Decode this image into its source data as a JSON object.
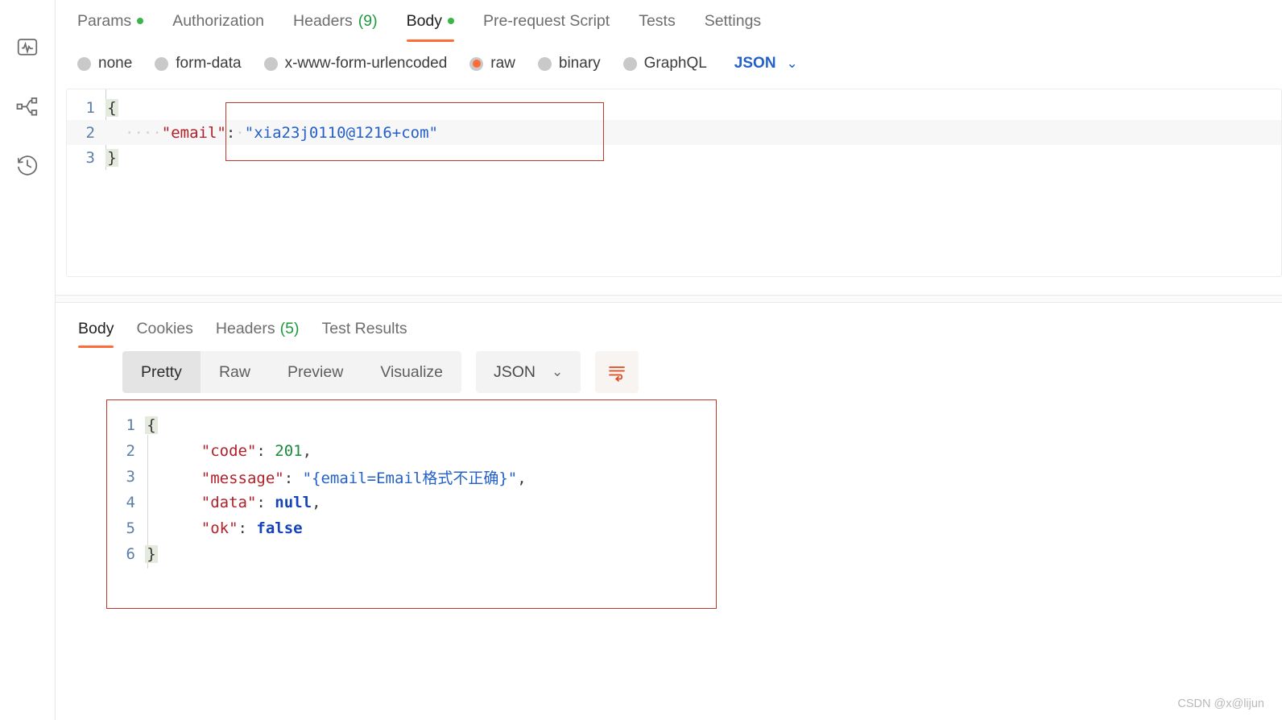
{
  "sidebar": {
    "items": [
      {
        "name": "monitor-icon",
        "label": "Monitors"
      },
      {
        "name": "flow-icon",
        "label": "Flows"
      },
      {
        "name": "history-icon",
        "label": "History"
      }
    ]
  },
  "request": {
    "tabs": [
      {
        "label": "Params",
        "badge_dot": true,
        "count": "",
        "active": false
      },
      {
        "label": "Authorization",
        "badge_dot": false,
        "count": "",
        "active": false
      },
      {
        "label": "Headers",
        "badge_dot": false,
        "count": "(9)",
        "active": false
      },
      {
        "label": "Body",
        "badge_dot": true,
        "count": "",
        "active": true
      },
      {
        "label": "Pre-request Script",
        "badge_dot": false,
        "count": "",
        "active": false
      },
      {
        "label": "Tests",
        "badge_dot": false,
        "count": "",
        "active": false
      },
      {
        "label": "Settings",
        "badge_dot": false,
        "count": "",
        "active": false
      }
    ],
    "body_types": [
      {
        "label": "none",
        "checked": false
      },
      {
        "label": "form-data",
        "checked": false
      },
      {
        "label": "x-www-form-urlencoded",
        "checked": false
      },
      {
        "label": "raw",
        "checked": true
      },
      {
        "label": "binary",
        "checked": false
      },
      {
        "label": "GraphQL",
        "checked": false
      }
    ],
    "language": "JSON",
    "language_chevron": "⌄",
    "editor": {
      "lines": [
        {
          "num": "1",
          "fold": "{",
          "tokens": []
        },
        {
          "num": "2",
          "fold": "",
          "tokens": [
            {
              "t": "ws",
              "v": "····"
            },
            {
              "t": "key",
              "v": "\"email\""
            },
            {
              "t": "punct",
              "v": ":"
            },
            {
              "t": "ws",
              "v": "·"
            },
            {
              "t": "str",
              "v": "\"xia23j0110@1216+com\""
            }
          ]
        },
        {
          "num": "3",
          "fold": "}",
          "tokens": []
        }
      ]
    }
  },
  "response": {
    "tabs": [
      {
        "label": "Body",
        "count": "",
        "active": true
      },
      {
        "label": "Cookies",
        "count": "",
        "active": false
      },
      {
        "label": "Headers",
        "count": "(5)",
        "active": false
      },
      {
        "label": "Test Results",
        "count": "",
        "active": false
      }
    ],
    "format_buttons": [
      {
        "label": "Pretty",
        "active": true
      },
      {
        "label": "Raw",
        "active": false
      },
      {
        "label": "Preview",
        "active": false
      },
      {
        "label": "Visualize",
        "active": false
      }
    ],
    "language": "JSON",
    "language_chevron": "⌄",
    "wrap_icon": "wrap-lines-icon",
    "body": {
      "lines": [
        {
          "num": "1",
          "fold": "{",
          "tokens": []
        },
        {
          "num": "2",
          "fold": "",
          "tokens": [
            {
              "t": "ws",
              "v": "    "
            },
            {
              "t": "key",
              "v": "\"code\""
            },
            {
              "t": "punct",
              "v": ": "
            },
            {
              "t": "num",
              "v": "201"
            },
            {
              "t": "punct",
              "v": ","
            }
          ]
        },
        {
          "num": "3",
          "fold": "",
          "tokens": [
            {
              "t": "ws",
              "v": "    "
            },
            {
              "t": "key",
              "v": "\"message\""
            },
            {
              "t": "punct",
              "v": ": "
            },
            {
              "t": "str",
              "v": "\"{email=Email格式不正确}\""
            },
            {
              "t": "punct",
              "v": ","
            }
          ]
        },
        {
          "num": "4",
          "fold": "",
          "tokens": [
            {
              "t": "ws",
              "v": "    "
            },
            {
              "t": "key",
              "v": "\"data\""
            },
            {
              "t": "punct",
              "v": ": "
            },
            {
              "t": "lit",
              "v": "null"
            },
            {
              "t": "punct",
              "v": ","
            }
          ]
        },
        {
          "num": "5",
          "fold": "",
          "tokens": [
            {
              "t": "ws",
              "v": "    "
            },
            {
              "t": "key",
              "v": "\"ok\""
            },
            {
              "t": "punct",
              "v": ": "
            },
            {
              "t": "lit",
              "v": "false"
            }
          ]
        },
        {
          "num": "6",
          "fold": "}",
          "tokens": []
        }
      ]
    }
  },
  "watermark": "CSDN @x@lijun",
  "colors": {
    "accent": "#ff6c37",
    "link": "#2360c9",
    "annotation": "#c0392b",
    "green_dot": "#3bb54a",
    "json_key": "#b02028",
    "json_string": "#2360c9",
    "json_number": "#1a8a3c",
    "json_literal": "#1544b8"
  }
}
